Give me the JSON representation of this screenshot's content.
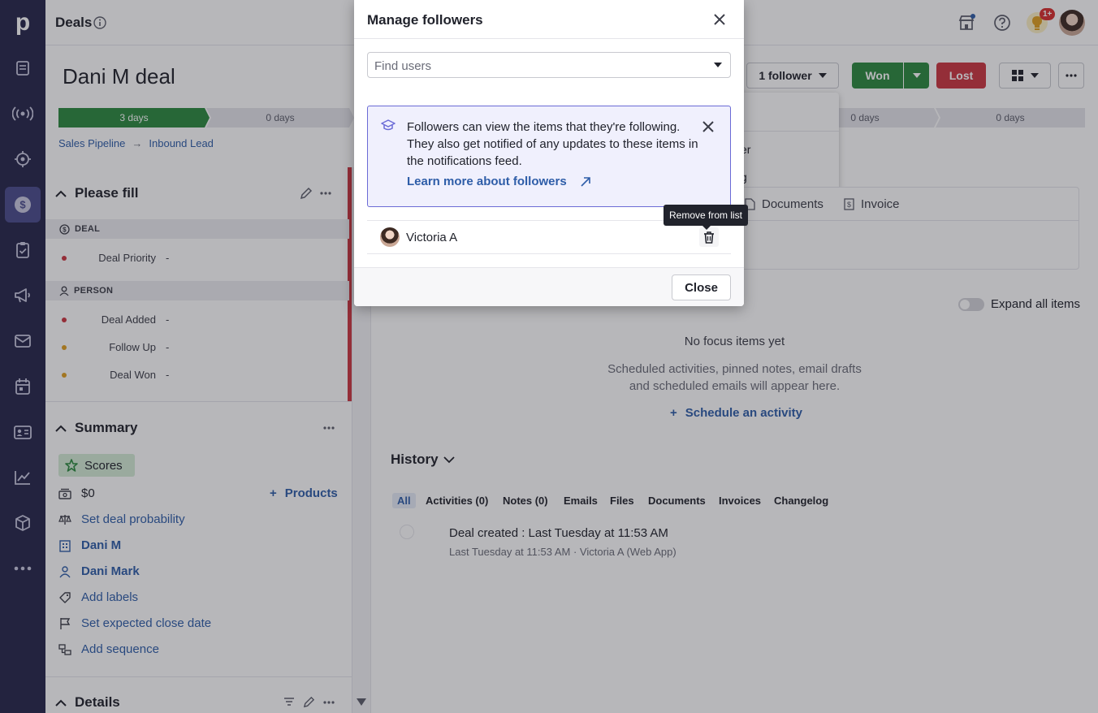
{
  "app": {
    "logo": "p",
    "page_title": "Deals"
  },
  "rail": {
    "items": [
      {
        "icon": "leads-icon"
      },
      {
        "icon": "broadcast-icon"
      },
      {
        "icon": "target-icon"
      },
      {
        "icon": "dollar-icon",
        "active": true
      },
      {
        "icon": "tasks-icon"
      },
      {
        "icon": "megaphone-icon"
      },
      {
        "icon": "mail-icon"
      },
      {
        "icon": "calendar-icon"
      },
      {
        "icon": "contacts-icon"
      },
      {
        "icon": "chart-icon"
      },
      {
        "icon": "box-icon"
      },
      {
        "icon": "more-icon"
      }
    ]
  },
  "topbar": {
    "notification_badge": "1+"
  },
  "deal": {
    "title": "Dani M deal",
    "stages": [
      {
        "label": "3 days",
        "done": true
      },
      {
        "label": "0 days",
        "done": false
      },
      {
        "label": "0 days",
        "done": false
      },
      {
        "label": "0 days",
        "done": false
      }
    ],
    "breadcrumb": [
      "Sales Pipeline",
      "Inbound Lead"
    ],
    "follower_button": "1 follower",
    "won_label": "Won",
    "lost_label": "Lost"
  },
  "follower_menu": {
    "item1_fragment": "er",
    "item2_fragment": "g"
  },
  "please_fill": {
    "title": "Please fill",
    "deal_band": "DEAL",
    "person_band": "PERSON",
    "fields": [
      {
        "label": "Deal Priority",
        "value": "-",
        "color": "#cc3540"
      },
      {
        "label": "Deal Added",
        "value": "-",
        "color": "#cc3540"
      },
      {
        "label": "Follow Up",
        "value": "-",
        "color": "#e0a020"
      },
      {
        "label": "Deal Won",
        "value": "-",
        "color": "#e0a020"
      }
    ]
  },
  "summary": {
    "title": "Summary",
    "scores": "Scores",
    "amount": "$0",
    "products": "Products",
    "probability": "Set deal probability",
    "org": "Dani M",
    "person": "Dani Mark",
    "labels": "Add labels",
    "close_date": "Set expected close date",
    "sequence": "Add sequence"
  },
  "details": {
    "title": "Details"
  },
  "tabs_card": {
    "documents": "Documents",
    "invoice": "Invoice"
  },
  "focus": {
    "expand_label": "Expand all items",
    "empty_title": "No focus items yet",
    "empty_desc_1": "Scheduled activities, pinned notes, email drafts",
    "empty_desc_2": "and scheduled emails will appear here.",
    "schedule": "Schedule an activity"
  },
  "history": {
    "title": "History",
    "tabs": [
      "All",
      "Activities (0)",
      "Notes (0)",
      "Emails",
      "Files",
      "Documents",
      "Invoices",
      "Changelog"
    ],
    "entry_title": "Deal created : Last Tuesday at 11:53 AM",
    "entry_meta": "Last Tuesday at 11:53 AM · Victoria A (Web App)"
  },
  "modal": {
    "title": "Manage followers",
    "search_placeholder": "Find users",
    "info_text": "Followers can view the items that they're following. They also get notified of any updates to these items in the notifications feed.",
    "info_link": "Learn more about followers",
    "followers": [
      {
        "name": "Victoria A"
      }
    ],
    "remove_tooltip": "Remove from list",
    "close_label": "Close"
  },
  "colors": {
    "rail": "#26264a",
    "won": "#2b8a3e",
    "lost": "#cc3540",
    "link": "#2e5da8"
  }
}
